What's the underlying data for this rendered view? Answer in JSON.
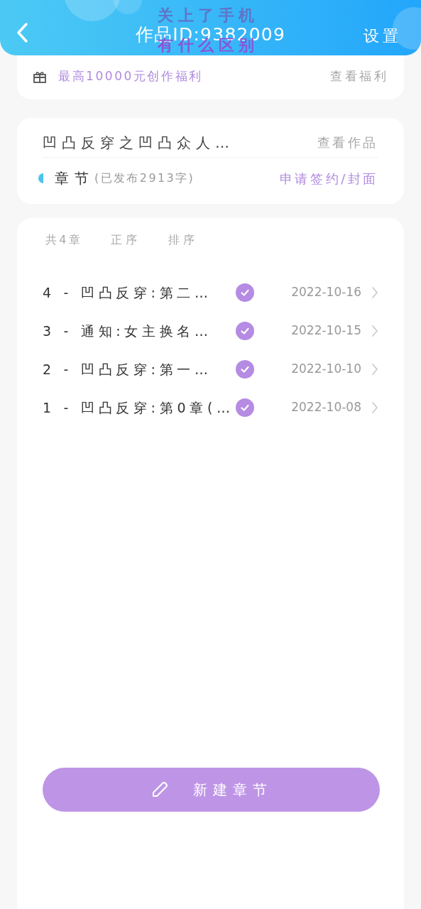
{
  "header": {
    "title": "作品ID:9382009",
    "settings": "设置"
  },
  "overlay_caption": [
    "关上了手机",
    "有什么区别"
  ],
  "welfare": {
    "text": "最高10000元创作福利",
    "link": "查看福利"
  },
  "work": {
    "title": "凹凸反穿之凹凸众人…",
    "link": "查看作品",
    "section": "章节",
    "published": "(已发布2913字)",
    "apply": "申请签约/封面"
  },
  "chapter_list": {
    "count": "共4章",
    "order": "正序",
    "sort": "排序",
    "rows": [
      {
        "title": "4 - 凹凸反穿:第二…",
        "checked": true,
        "date": "2022-10-16"
      },
      {
        "title": "3 - 通知:女主换名…",
        "checked": true,
        "date": "2022-10-15"
      },
      {
        "title": "2 - 凹凸反穿:第一…",
        "checked": true,
        "date": "2022-10-10"
      },
      {
        "title": "1 - 凹凸反穿:第0章(…",
        "checked": true,
        "date": "2022-10-08"
      }
    ]
  },
  "new_chapter_button": "新建章节"
}
